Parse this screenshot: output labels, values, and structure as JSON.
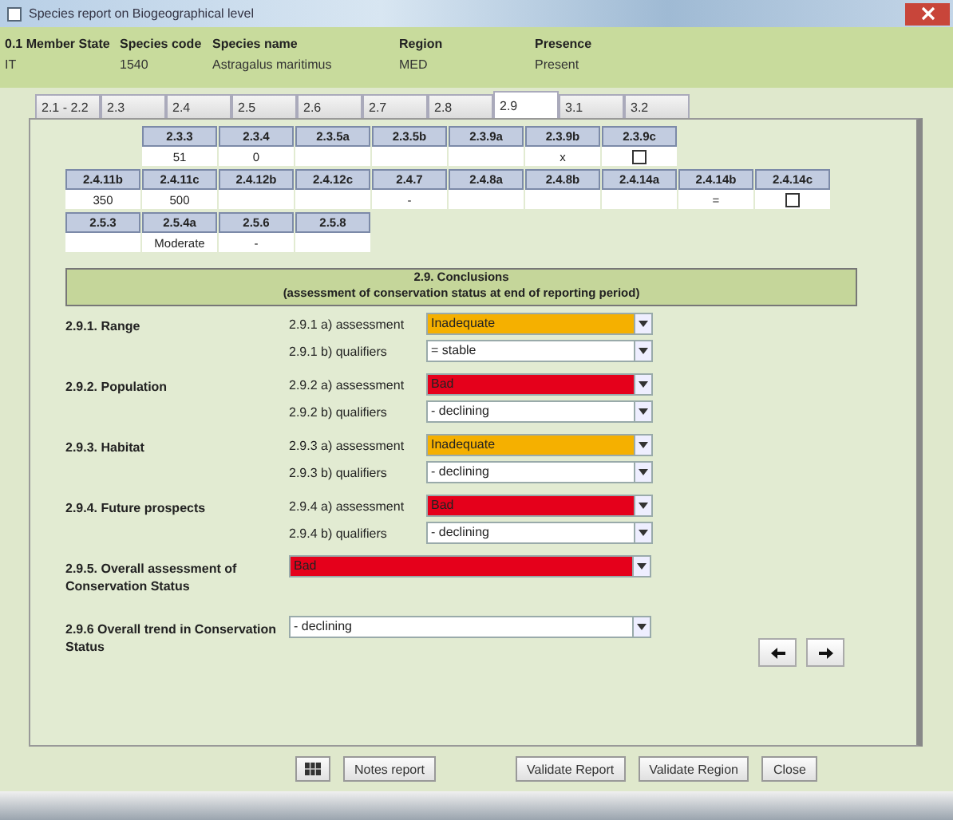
{
  "window": {
    "title": "Species report on Biogeographical level"
  },
  "header": [
    {
      "label": "0.1 Member State",
      "value": "IT"
    },
    {
      "label": "Species code",
      "value": "1540"
    },
    {
      "label": "Species name",
      "value": "Astragalus maritimus"
    },
    {
      "label": "Region",
      "value": "MED"
    },
    {
      "label": "Presence",
      "value": "Present"
    }
  ],
  "tabs": [
    {
      "label": "2.1 - 2.2",
      "selected": false
    },
    {
      "label": "2.3",
      "selected": false
    },
    {
      "label": "2.4",
      "selected": false
    },
    {
      "label": "2.5",
      "selected": false
    },
    {
      "label": "2.6",
      "selected": false
    },
    {
      "label": "2.7",
      "selected": false
    },
    {
      "label": "2.8",
      "selected": false
    },
    {
      "label": "2.9",
      "selected": true
    },
    {
      "label": "3.1",
      "selected": false
    },
    {
      "label": "3.2",
      "selected": false
    }
  ],
  "grids": [
    {
      "cells": [
        {
          "header": "2.3.3",
          "kind": "text",
          "value": "51"
        },
        {
          "header": "2.3.4",
          "kind": "text",
          "value": "0"
        },
        {
          "header": "2.3.5a",
          "kind": "text"
        },
        {
          "header": "2.3.5b",
          "kind": "text"
        },
        {
          "header": "2.3.9a",
          "kind": "text"
        },
        {
          "header": "2.3.9b",
          "kind": "text",
          "value": "x"
        },
        {
          "header": "2.3.9c",
          "kind": "checkbox",
          "checked": false
        }
      ]
    },
    {
      "cells": [
        {
          "header": "2.4.11b",
          "kind": "text",
          "value": "350"
        },
        {
          "header": "2.4.11c",
          "kind": "text",
          "value": "500"
        },
        {
          "header": "2.4.12b",
          "kind": "text"
        },
        {
          "header": "2.4.12c",
          "kind": "text"
        },
        {
          "header": "2.4.7",
          "kind": "text",
          "value": "-"
        },
        {
          "header": "2.4.8a",
          "kind": "text"
        },
        {
          "header": "2.4.8b",
          "kind": "text"
        },
        {
          "header": "2.4.14a",
          "kind": "text"
        },
        {
          "header": "2.4.14b",
          "kind": "text",
          "value": "="
        },
        {
          "header": "2.4.14c",
          "kind": "checkbox",
          "checked": false
        }
      ]
    },
    {
      "cells": [
        {
          "header": "2.5.3",
          "kind": "text"
        },
        {
          "header": "2.5.4a",
          "kind": "text",
          "value": "Moderate"
        },
        {
          "header": "2.5.6",
          "kind": "text",
          "value": "-"
        },
        {
          "header": "2.5.8",
          "kind": "text"
        }
      ]
    }
  ],
  "conclusions": {
    "title": "2.9. Conclusions",
    "subtitle": "(assessment of conservation status at end of reporting period)",
    "groups": [
      {
        "label": "2.9.1. Range",
        "fields": [
          {
            "label": "2.9.1 a) assessment",
            "value": "Inadequate",
            "color": "#f5b000"
          },
          {
            "label": "2.9.1 b) qualifiers",
            "value": "= stable"
          }
        ]
      },
      {
        "label": "2.9.2. Population",
        "fields": [
          {
            "label": "2.9.2 a) assessment",
            "value": "Bad",
            "color": "#e5001b"
          },
          {
            "label": "2.9.2 b) qualifiers",
            "value": "- declining"
          }
        ]
      },
      {
        "label": "2.9.3. Habitat",
        "fields": [
          {
            "label": "2.9.3 a) assessment",
            "value": "Inadequate",
            "color": "#f5b000"
          },
          {
            "label": "2.9.3 b) qualifiers",
            "value": "- declining"
          }
        ]
      },
      {
        "label": "2.9.4. Future prospects",
        "fields": [
          {
            "label": "2.9.4 a) assessment",
            "value": "Bad",
            "color": "#e5001b"
          },
          {
            "label": "2.9.4 b) qualifiers",
            "value": "- declining"
          }
        ]
      },
      {
        "label": "2.9.5. Overall assessment of Conservation Status",
        "fields": [
          {
            "value": "Bad",
            "color": "#e5001b"
          }
        ]
      },
      {
        "label": "2.9.6 Overall trend in Conservation Status",
        "fields": [
          {
            "value": "- declining"
          }
        ]
      }
    ]
  },
  "nav_buttons": [
    {
      "kind": "previous"
    },
    {
      "kind": "next"
    }
  ],
  "buttons": [
    {
      "label": "Notes report"
    },
    {
      "label": "Validate Report"
    },
    {
      "label": "Validate Region"
    },
    {
      "label": "Close"
    }
  ]
}
